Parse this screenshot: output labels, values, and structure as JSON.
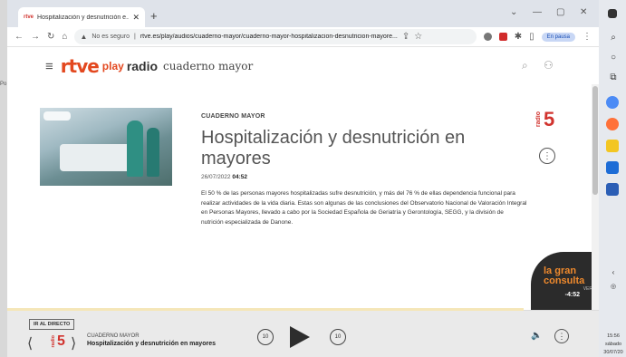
{
  "browser": {
    "tab_title": "Hospitalización y desnutrición e...",
    "tab_favicon": "rtve",
    "new_tab": "+",
    "url_warning": "No es seguro",
    "url": "rtve.es/play/audios/cuaderno-mayor/cuaderno-mayor-hospitalizacion-desnutricion-mayore...",
    "pause_label": "En pausa",
    "window_controls": [
      "⌄",
      "—",
      "▢",
      "✕"
    ]
  },
  "site": {
    "logo_rtve": "rtve",
    "logo_play": "play",
    "logo_radio": "radio",
    "program": "cuaderno mayor"
  },
  "episode": {
    "kicker": "CUADERNO MAYOR",
    "title": "Hospitalización y desnutrición en mayores",
    "date": "26/07/2022",
    "duration": "04:52",
    "description": "El 50 % de las personas mayores hospitalizadas sufre desnutrición, y más del 76 % de ellas dependencia funcional para realizar actividades de la vida diaria. Estas son algunas de las conclusiones del Observatorio Nacional de Valoración Integral en Personas Mayores, llevado a cabo por la Sociedad Española de Geriatría y Gerontología, SEGG, y la división de nutrición especializada de Danone.",
    "station_radio": "radio",
    "station_number": "5"
  },
  "badge": {
    "line1": "la gran",
    "line2": "consulta",
    "ver": "VER",
    "time": "-4:52"
  },
  "player": {
    "live_button": "IR AL DIRECTO",
    "kicker": "CUADERNO MAYOR",
    "title": "Hospitalización y desnutrición en mayores",
    "skip_back": "10",
    "skip_fwd": "10",
    "station_radio": "radio",
    "station_number": "5",
    "progress": 0.0
  },
  "taskbar": {
    "time": "15:56",
    "day": "sábado",
    "date": "30/07/20"
  },
  "colors": {
    "brand": "#e3481f",
    "radio5": "#d1332e",
    "badge_text": "#f08a2d"
  }
}
